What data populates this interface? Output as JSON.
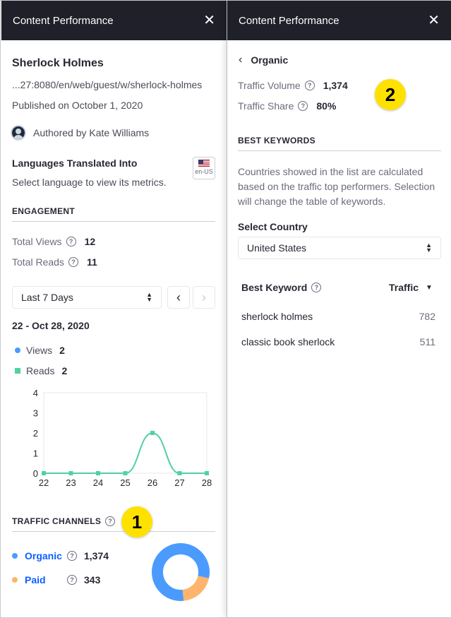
{
  "left": {
    "header_title": "Content Performance",
    "close_glyph": "✕",
    "article_title": "Sherlock Holmes",
    "url": "...27:8080/en/web/guest/w/sherlock-holmes",
    "published": "Published on October 1, 2020",
    "author": "Authored by Kate Williams",
    "languages_title": "Languages Translated Into",
    "languages_hint": "Select language to view its metrics.",
    "flag_label": "en-US",
    "engagement_label": "ENGAGEMENT",
    "total_views_label": "Total Views",
    "total_views_value": "12",
    "total_reads_label": "Total Reads",
    "total_reads_value": "11",
    "range_select": "Last 7 Days",
    "prev_glyph": "‹",
    "next_glyph": "›",
    "date_range": "22 - Oct 28, 2020",
    "legend_views_label": "Views",
    "legend_views_value": "2",
    "legend_reads_label": "Reads",
    "legend_reads_value": "2",
    "traffic_channels_label": "TRAFFIC CHANNELS",
    "organic_label": "Organic",
    "organic_value": "1,374",
    "paid_label": "Paid",
    "paid_value": "343",
    "badge": "1"
  },
  "right": {
    "header_title": "Content Performance",
    "close_glyph": "✕",
    "back_label": "Organic",
    "traffic_volume_label": "Traffic Volume",
    "traffic_volume_value": "1,374",
    "traffic_share_label": "Traffic Share",
    "traffic_share_value": "80%",
    "badge": "2",
    "best_keywords_label": "BEST KEYWORDS",
    "description": "Countries showed in the list are calculated based on the traffic top performers. Selection will change the table of keywords.",
    "select_country_label": "Select Country",
    "country_value": "United States",
    "col_keyword": "Best Keyword",
    "col_traffic": "Traffic",
    "keywords": [
      {
        "keyword": "sherlock holmes",
        "traffic": "782"
      },
      {
        "keyword": "classic book sherlock",
        "traffic": "511"
      }
    ]
  },
  "colors": {
    "header_bg": "#1f2029",
    "views": "#4b9bff",
    "reads": "#50d2a0",
    "organic": "#4b9bff",
    "paid": "#ffb46e",
    "badge": "#ffe100"
  },
  "chart_data": {
    "type": "line",
    "x": [
      "22",
      "23",
      "24",
      "25",
      "26",
      "27",
      "28"
    ],
    "ylim": [
      0,
      4
    ],
    "yticks": [
      "0",
      "1",
      "2",
      "3",
      "4"
    ],
    "series": [
      {
        "name": "Views",
        "values": [
          0,
          0,
          0,
          0,
          2,
          0,
          0
        ]
      },
      {
        "name": "Reads",
        "values": [
          0,
          0,
          0,
          0,
          2,
          0,
          0
        ]
      }
    ]
  },
  "donut_data": {
    "type": "pie",
    "categories": [
      "Organic",
      "Paid"
    ],
    "values": [
      1374,
      343
    ]
  }
}
